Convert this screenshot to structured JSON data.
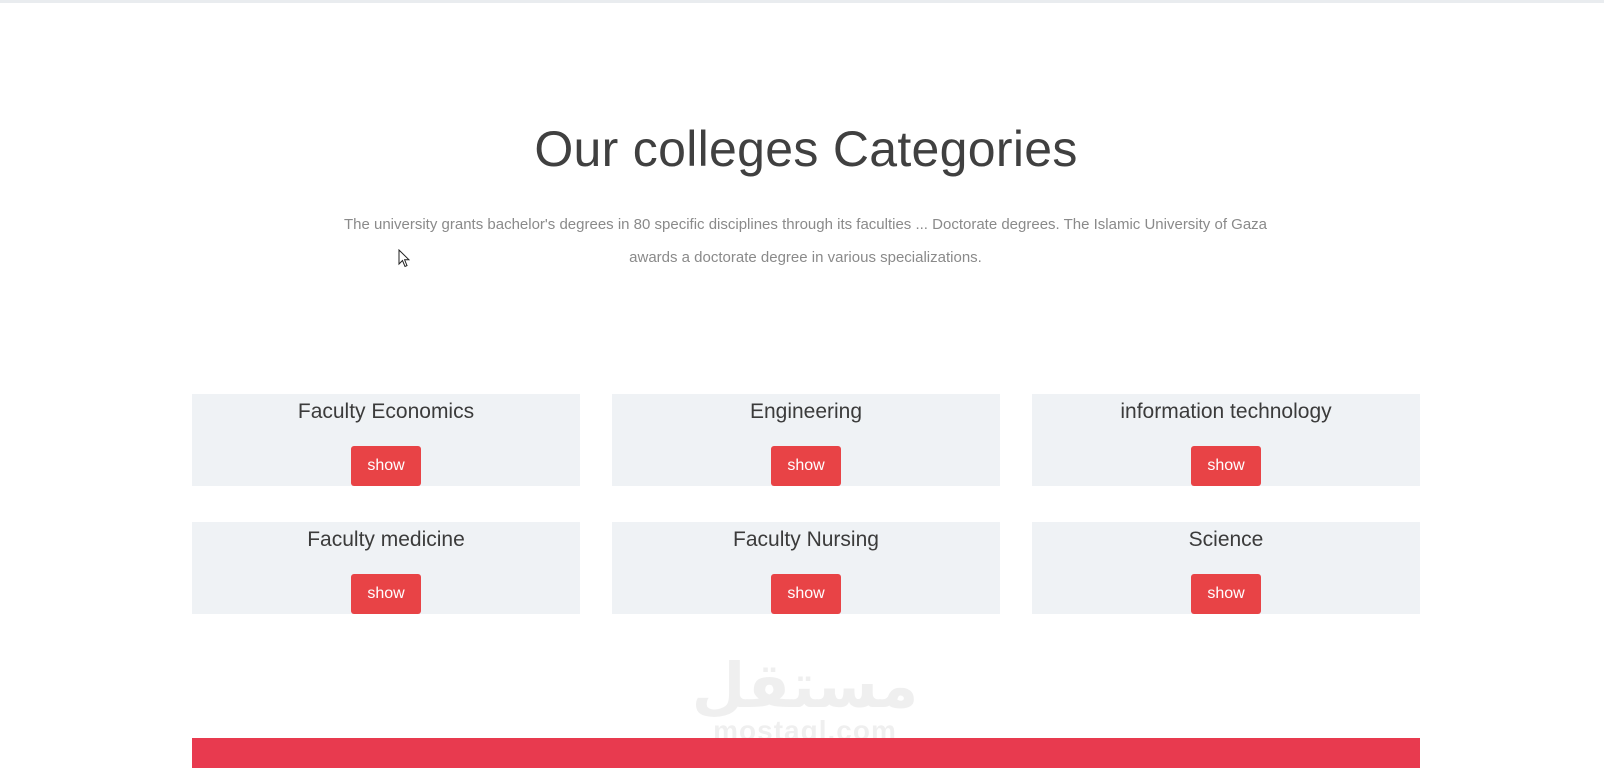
{
  "section": {
    "title": "Our colleges Categories",
    "description": "The university grants bachelor's degrees in 80 specific disciplines through its faculties ... Doctorate degrees. The Islamic University of Gaza awards a doctorate degree in various specializations."
  },
  "categories": [
    {
      "title": "Faculty Economics",
      "button": "show"
    },
    {
      "title": "Engineering",
      "button": "show"
    },
    {
      "title": "information technology",
      "button": "show"
    },
    {
      "title": "Faculty medicine",
      "button": "show"
    },
    {
      "title": "Faculty Nursing",
      "button": "show"
    },
    {
      "title": "Science",
      "button": "show"
    }
  ],
  "watermark": {
    "logo": "مستقل",
    "text": "mostaql.com"
  },
  "colors": {
    "accent": "#e84346",
    "card_bg": "#eff2f5",
    "footer_band": "#e83a4f"
  },
  "icons": [
    "mouse-cursor-icon"
  ]
}
